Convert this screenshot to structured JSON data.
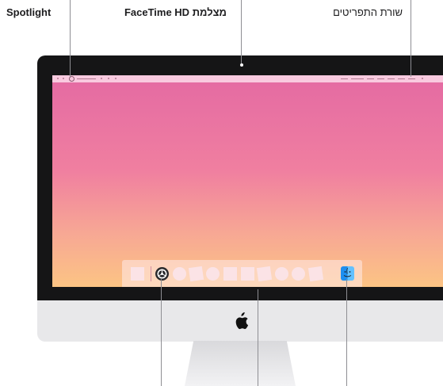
{
  "labels": {
    "spotlight": "Spotlight",
    "facetime_camera": "מצלמת FaceTime HD",
    "menu_bar": "שורת התפריטים"
  },
  "colors": {
    "bezel": "#151516",
    "chin": "#e8e8ea",
    "wallpaper_top": "#e46aa3",
    "wallpaper_bottom": "#fcc484",
    "leader_line": "#8e8e93"
  },
  "icons": {
    "dock_system_preferences": "gear-icon",
    "dock_finder": "finder-icon",
    "chin_logo": "apple-logo-icon",
    "menubar_search": "search-icon"
  }
}
